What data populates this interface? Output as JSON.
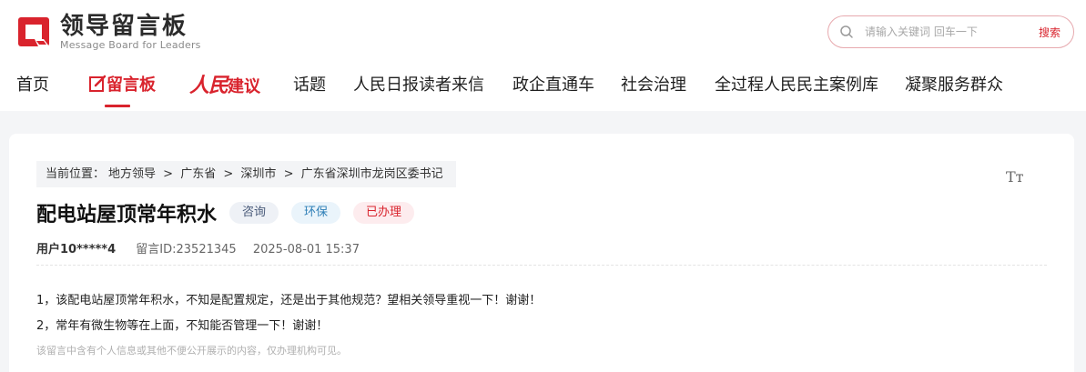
{
  "header": {
    "logo_cn": "领导留言板",
    "logo_en": "Message Board for Leaders",
    "logo_icon": "board-logo-icon",
    "search": {
      "placeholder": "请输入关键词 回车一下",
      "button_label": "搜索",
      "icon": "search-icon"
    }
  },
  "nav": {
    "items": [
      {
        "label": "首页"
      },
      {
        "label": "留言板",
        "icon": "pen-edit-icon"
      },
      {
        "label_a": "人民",
        "label_b": "建议"
      },
      {
        "label": "话题"
      },
      {
        "label": "人民日报读者来信"
      },
      {
        "label": "政企直通车"
      },
      {
        "label": "社会治理"
      },
      {
        "label": "全过程人民民主案例库"
      },
      {
        "label": "凝聚服务群众"
      }
    ]
  },
  "article": {
    "breadcrumb": {
      "prefix": "当前位置：",
      "parts": [
        "地方领导",
        "广东省",
        "深圳市",
        "广东省深圳市龙岗区委书记"
      ],
      "separator": ">"
    },
    "font_toggle": "Tт",
    "title": "配电站屋顶常年积水",
    "tags": [
      "咨询",
      "环保",
      "已办理"
    ],
    "meta": {
      "user": "用户10*****4",
      "message_id": "留言ID:23521345",
      "datetime": "2025-08-01 15:37"
    },
    "body": [
      "1，该配电站屋顶常年积水，不知是配置规定，还是出于其他规范？望相关领导重视一下！谢谢！",
      "2，常年有微生物等在上面，不知能否管理一下！谢谢！"
    ],
    "privacy_note": "该留言中含有个人信息或其他不便公开展示的内容，仅办理机构可见。"
  },
  "colors": {
    "brand_red": "#d9232d",
    "page_bg": "#f4f5f7",
    "card_bg": "#ffffff"
  }
}
